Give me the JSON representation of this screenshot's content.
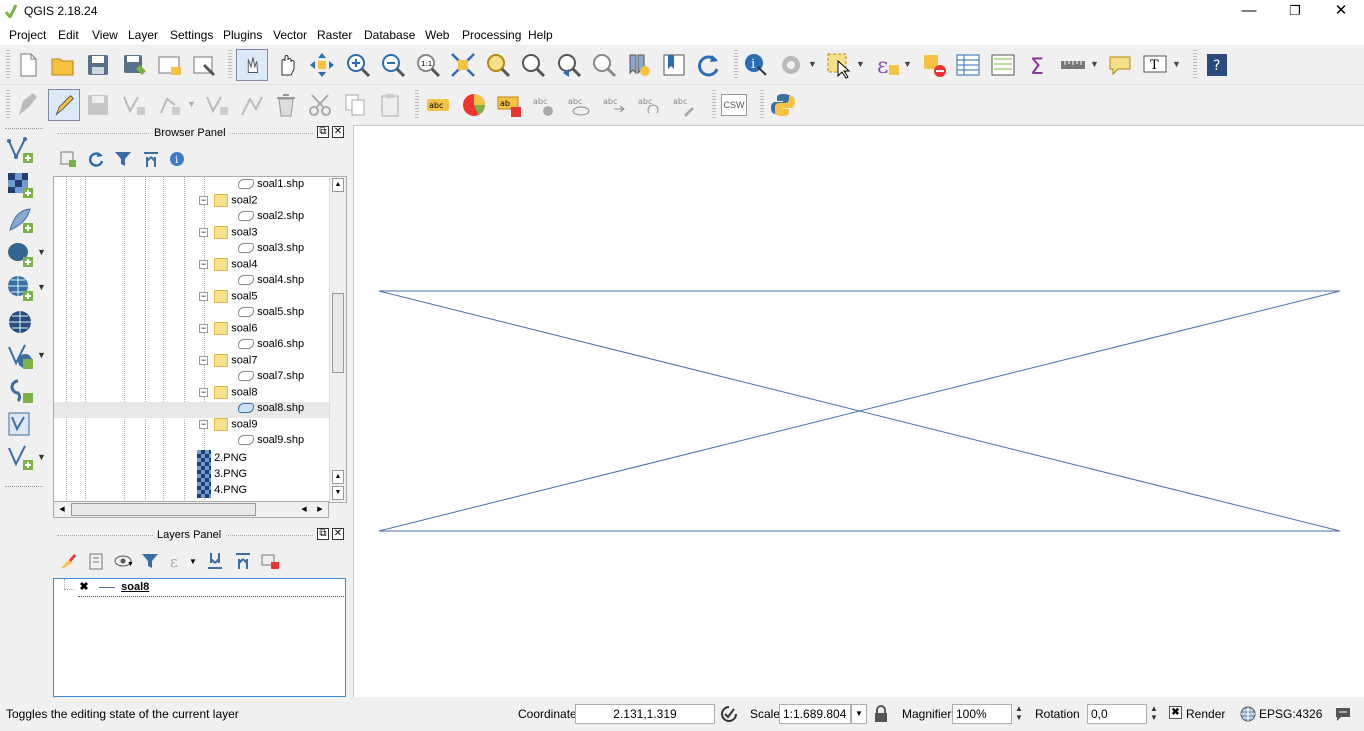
{
  "window": {
    "title": "QGIS 2.18.24",
    "minimize": "—",
    "restore": "❐",
    "close": "✕"
  },
  "menu": [
    "Project",
    "Edit",
    "View",
    "Layer",
    "Settings",
    "Plugins",
    "Vector",
    "Raster",
    "Database",
    "Web",
    "Processing",
    "Help"
  ],
  "browser_panel": {
    "title": "Browser Panel",
    "items": [
      {
        "label": "soal1.shp",
        "kind": "shp"
      },
      {
        "label": "soal2",
        "kind": "folder"
      },
      {
        "label": "soal2.shp",
        "kind": "shp"
      },
      {
        "label": "soal3",
        "kind": "folder"
      },
      {
        "label": "soal3.shp",
        "kind": "shp"
      },
      {
        "label": "soal4",
        "kind": "folder"
      },
      {
        "label": "soal4.shp",
        "kind": "shp"
      },
      {
        "label": "soal5",
        "kind": "folder"
      },
      {
        "label": "soal5.shp",
        "kind": "shp"
      },
      {
        "label": "soal6",
        "kind": "folder"
      },
      {
        "label": "soal6.shp",
        "kind": "shp"
      },
      {
        "label": "soal7",
        "kind": "folder"
      },
      {
        "label": "soal7.shp",
        "kind": "shp"
      },
      {
        "label": "soal8",
        "kind": "folder"
      },
      {
        "label": "soal8.shp",
        "kind": "shp",
        "selected": true
      },
      {
        "label": "soal9",
        "kind": "folder"
      },
      {
        "label": "soal9.shp",
        "kind": "shp"
      },
      {
        "label": "2.PNG",
        "kind": "png"
      },
      {
        "label": "3.PNG",
        "kind": "png"
      },
      {
        "label": "4.PNG",
        "kind": "png"
      }
    ]
  },
  "layers_panel": {
    "title": "Layers Panel",
    "layers": [
      {
        "name": "soal8",
        "visible": true
      }
    ]
  },
  "toolbar2": {
    "csw_label": "CSW"
  },
  "status": {
    "message": "Toggles the editing state of the current layer",
    "coordinate_label": "Coordinate",
    "coordinate_value": "2.131,1.319",
    "scale_label": "Scale",
    "scale_value": "1:1.689.804",
    "magnifier_label": "Magnifier",
    "magnifier_value": "100%",
    "rotation_label": "Rotation",
    "rotation_value": "0,0",
    "render_label": "Render",
    "crs": "EPSG:4326"
  },
  "colors": {
    "canvas_line": "#4a6ea9",
    "selected_row": "#e8e8e8",
    "focus_border": "#3b8fd6"
  }
}
